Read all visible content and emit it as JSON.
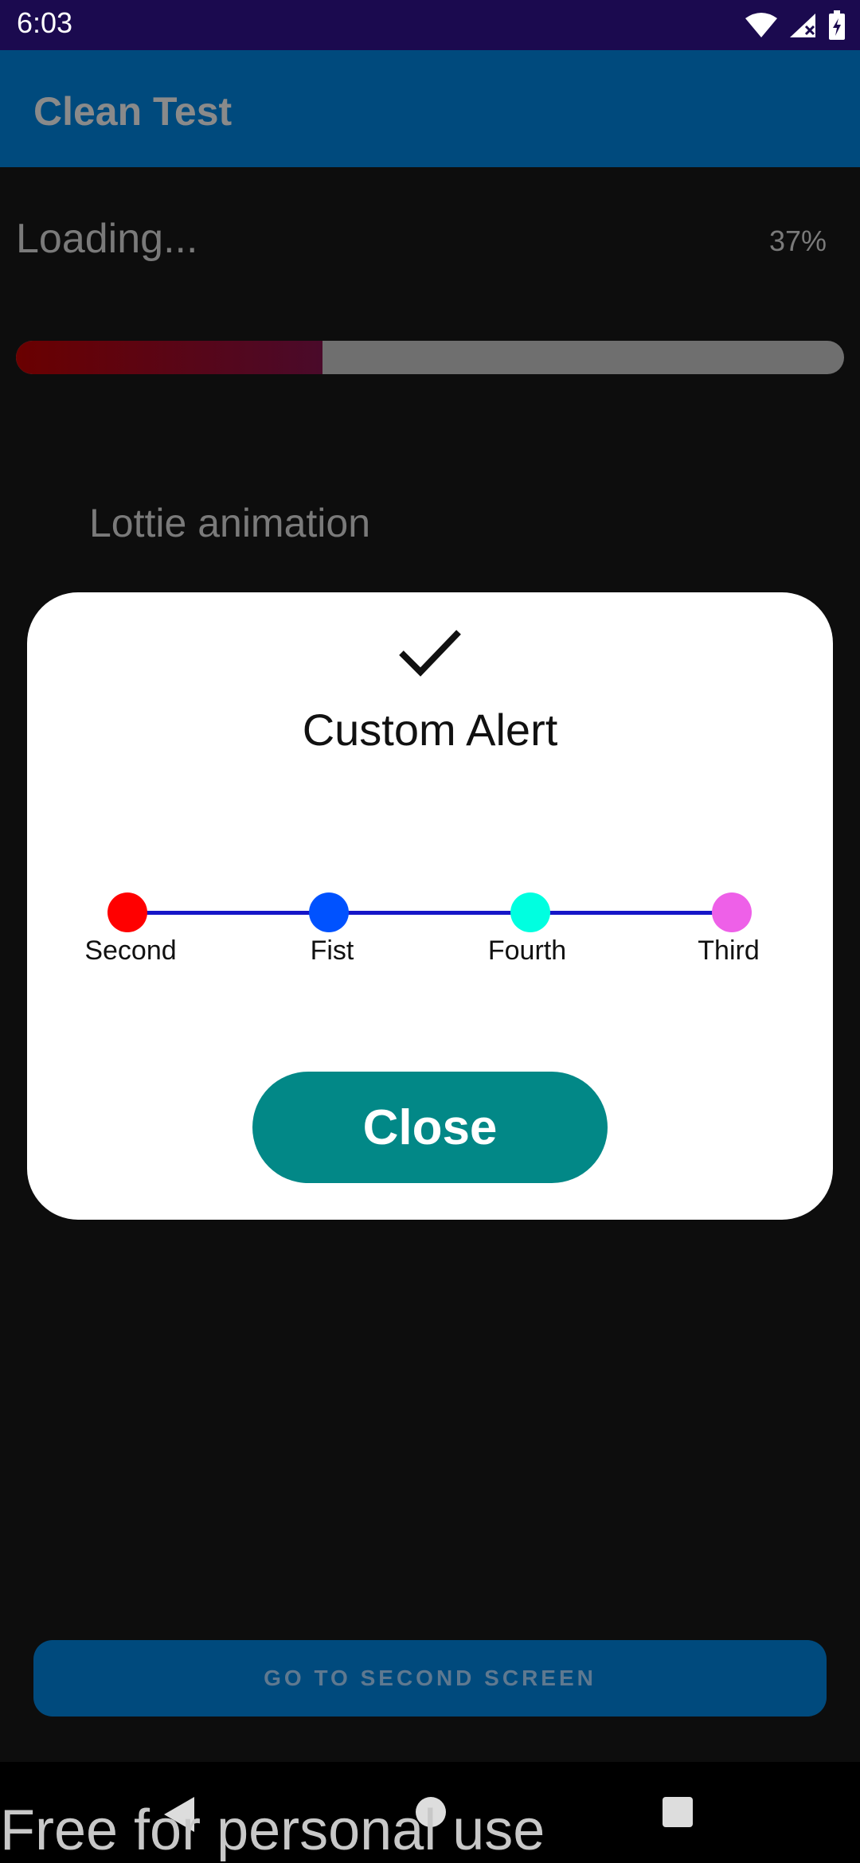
{
  "status_bar": {
    "time": "6:03"
  },
  "app_bar": {
    "title": "Clean Test"
  },
  "loading": {
    "label": "Loading...",
    "percent_text": "37%",
    "progress": 0.37
  },
  "lottie": {
    "label": "Lottie animation"
  },
  "next_button": {
    "label": "GO TO SECOND SCREEN"
  },
  "dialog": {
    "title": "Custom Alert",
    "close_label": "Close",
    "steps": [
      {
        "label": "Second",
        "color": "#ff0000"
      },
      {
        "label": "Fist",
        "color": "#0052ff"
      },
      {
        "label": "Fourth",
        "color": "#00ffe0"
      },
      {
        "label": "Third",
        "color": "#ee60e8"
      }
    ],
    "line_color": "#1616c8"
  },
  "watermark": "Free for personal use"
}
